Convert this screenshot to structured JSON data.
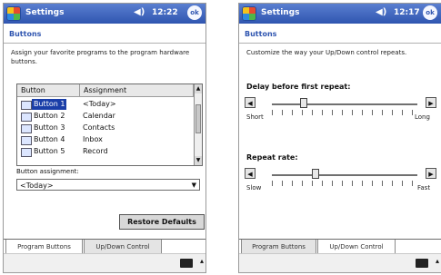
{
  "left": {
    "title": "Settings",
    "clock": "12:22",
    "ok_label": "ok",
    "heading": "Buttons",
    "description": "Assign your favorite programs to the program hardware buttons.",
    "columns": [
      "Button",
      "Assignment"
    ],
    "rows": [
      {
        "button": "Button 1",
        "assignment": "<Today>"
      },
      {
        "button": "Button 2",
        "assignment": "Calendar"
      },
      {
        "button": "Button 3",
        "assignment": "Contacts"
      },
      {
        "button": "Button 4",
        "assignment": "Inbox"
      },
      {
        "button": "Button 5",
        "assignment": "Record"
      }
    ],
    "selected_row": 0,
    "field_label": "Button assignment:",
    "field_value": "<Today>",
    "restore_button": "Restore Defaults",
    "tabs": [
      "Program Buttons",
      "Up/Down Control"
    ],
    "active_tab": 0
  },
  "right": {
    "title": "Settings",
    "clock": "12:17",
    "ok_label": "ok",
    "heading": "Buttons",
    "description": "Customize the way your Up/Down control repeats.",
    "delay_label": "Delay before first repeat:",
    "delay_min": "Short",
    "delay_max": "Long",
    "delay_value_fraction": 0.22,
    "rate_label": "Repeat rate:",
    "rate_min": "Slow",
    "rate_max": "Fast",
    "rate_value_fraction": 0.3,
    "tabs": [
      "Program Buttons",
      "Up/Down Control"
    ],
    "active_tab": 1
  }
}
